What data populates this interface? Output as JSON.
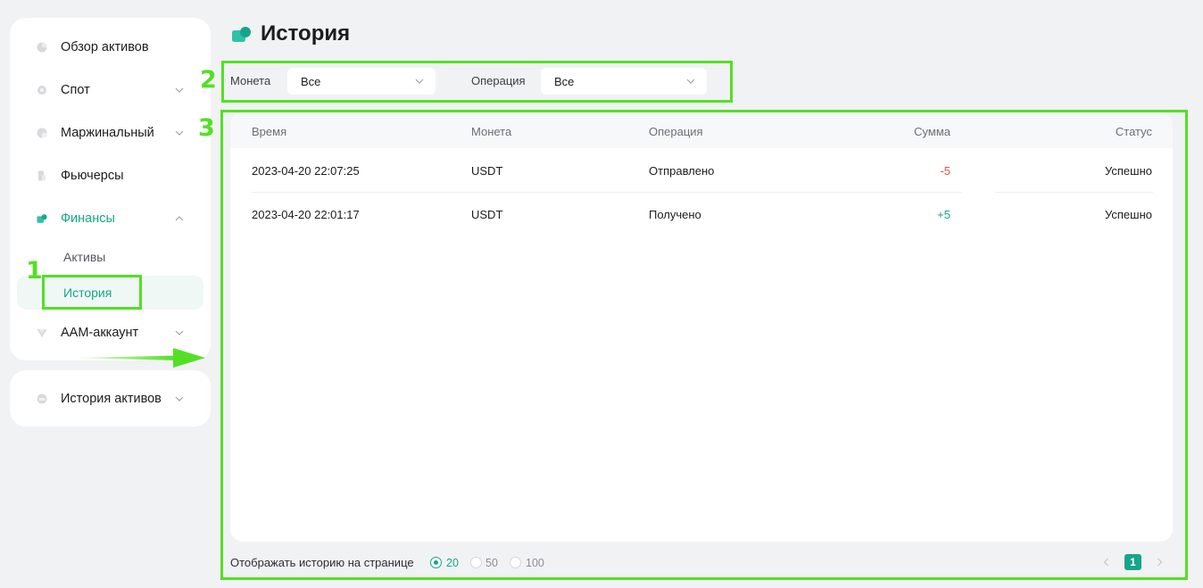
{
  "sidebar": {
    "items": [
      {
        "label": "Обзор активов",
        "icon": "pie-chart-icon"
      },
      {
        "label": "Спот",
        "icon": "gear-icon"
      },
      {
        "label": "Маржинальный",
        "icon": "margin-icon"
      },
      {
        "label": "Фьючерсы",
        "icon": "futures-icon"
      },
      {
        "label": "Финансы",
        "icon": "finance-icon"
      },
      {
        "label": "ААМ-аккаунт",
        "icon": "amm-icon"
      }
    ],
    "finance_sub": [
      {
        "label": "Активы"
      },
      {
        "label": "История"
      }
    ],
    "history_assets": {
      "label": "История активов",
      "icon": "wallet-icon"
    }
  },
  "page": {
    "title": "История"
  },
  "filters": {
    "coin": {
      "label": "Монета",
      "value": "Все"
    },
    "operation": {
      "label": "Операция",
      "value": "Все"
    }
  },
  "table": {
    "columns": [
      "Время",
      "Монета",
      "Операция",
      "Сумма",
      "Статус"
    ],
    "rows": [
      {
        "time": "2023-04-20 22:07:25",
        "coin": "USDT",
        "operation": "Отправлено",
        "amount": "-5",
        "status": "Успешно"
      },
      {
        "time": "2023-04-20 22:01:17",
        "coin": "USDT",
        "operation": "Получено",
        "amount": "+5",
        "status": "Успешно"
      }
    ]
  },
  "footer": {
    "per_page_label": "Отображать историю на странице",
    "options": [
      "20",
      "50",
      "100"
    ],
    "selected": "20",
    "current_page": "1"
  },
  "annotations": {
    "n1": "1",
    "n2": "2",
    "n3": "3"
  },
  "colors": {
    "accent": "#17a589",
    "negative": "#e0533f",
    "annotation": "#53e024"
  }
}
